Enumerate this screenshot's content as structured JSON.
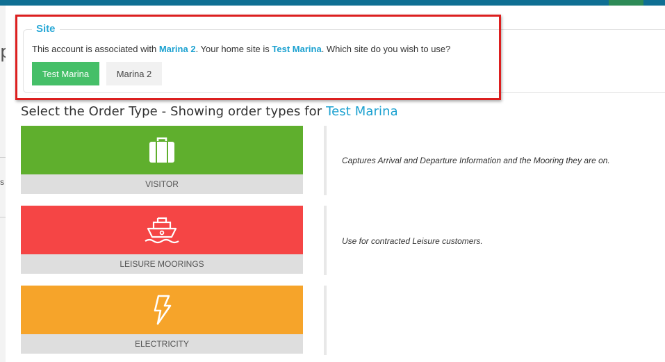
{
  "site": {
    "legend": "Site",
    "message": {
      "prefix": "This account is associated with ",
      "associated_site": "Marina 2",
      "middle": ". Your home site is ",
      "home_site": "Test Marina",
      "suffix": ". Which site do you wish to use?"
    },
    "buttons": {
      "test_marina": "Test Marina",
      "marina_2": "Marina 2"
    }
  },
  "heading": {
    "prefix": "Select the Order Type - Showing order types for ",
    "site_name": "Test Marina"
  },
  "order_types": [
    {
      "label": "VISITOR",
      "icon": "suitcase-icon",
      "color": "#5faf2d",
      "description": "Captures Arrival and Departure Information and the Mooring they are on."
    },
    {
      "label": "LEISURE MOORINGS",
      "icon": "ship-icon",
      "color": "#f54545",
      "description": "Use for contracted Leisure customers."
    },
    {
      "label": "ELECTRICITY",
      "icon": "lightning-icon",
      "color": "#f6a42a",
      "description": ""
    }
  ],
  "background": {
    "left_glyph": "p",
    "left_letter": "s"
  },
  "colors": {
    "accent": "#1ba1d0",
    "primary_button": "#45bf68",
    "highlight_border": "#dc1f1f",
    "top_bar": "#0f6f93"
  }
}
